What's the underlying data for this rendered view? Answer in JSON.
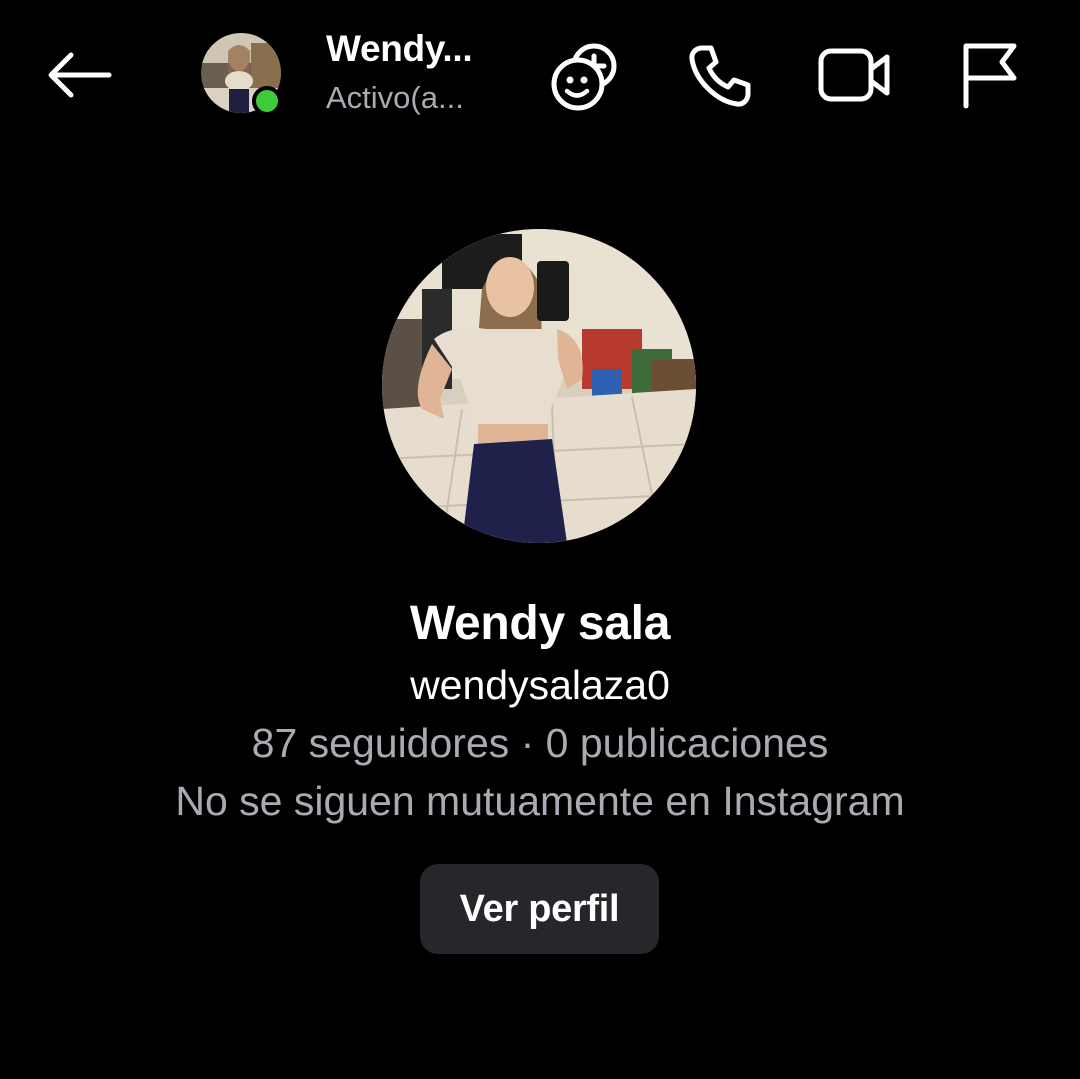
{
  "header": {
    "back_icon": "arrow-left-icon",
    "contact_name": "Wendy...",
    "status_text": "Activo(a...",
    "online_color": "#3ecb3a",
    "effects_icon": "sticker-add-icon",
    "call_icon": "phone-icon",
    "video_icon": "video-camera-icon",
    "flag_icon": "flag-icon"
  },
  "profile": {
    "display_name": "Wendy sala",
    "username": "wendysalaza0",
    "stats": "87 seguidores · 0 publicaciones",
    "mutual": "No se siguen mutuamente en Instagram",
    "view_profile_label": "Ver perfil"
  },
  "colors": {
    "background": "#000000",
    "secondary_text": "#a8abb2",
    "button_bg": "#25272b"
  }
}
